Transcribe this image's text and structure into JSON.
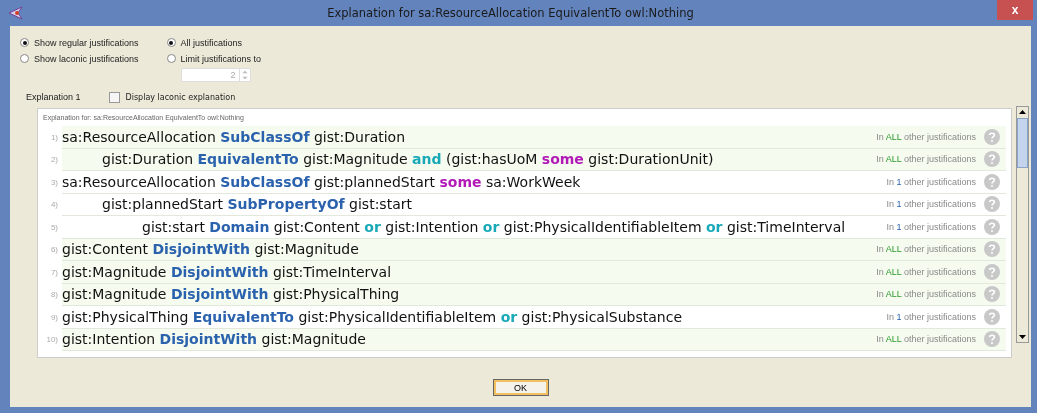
{
  "window": {
    "title": "Explanation for sa:ResourceAllocation EquivalentTo owl:Nothing",
    "close": "x"
  },
  "display_mode": [
    {
      "label": "Show regular justifications",
      "selected": true
    },
    {
      "label": "Show laconic justifications",
      "selected": false
    }
  ],
  "limit_mode": [
    {
      "label": "All justifications",
      "selected": true
    },
    {
      "label": "Limit justifications to",
      "selected": false
    }
  ],
  "limit_spinner": {
    "value": "2",
    "disabled": true
  },
  "explanation": {
    "label": "Explanation 1",
    "laconic_checkbox": {
      "label": "Display laconic explanation",
      "checked": false
    },
    "header": "Explanation for: sa:ResourceAllocation EquivalentTo owl:Nothing",
    "rows": [
      {
        "number": "1)",
        "shared": true,
        "usage": {
          "prefix": "In",
          "count": "ALL",
          "suffix": "other justifications"
        },
        "segments": [
          {
            "text": "sa:ResourceAllocation",
            "kind": "entity"
          },
          {
            "text": "SubClassOf",
            "kind": "keyword"
          },
          {
            "text": "gist:Duration",
            "kind": "entity"
          }
        ],
        "children": [
          {
            "number": "2)",
            "shared": true,
            "usage": {
              "prefix": "In",
              "count": "ALL",
              "suffix": "other justifications"
            },
            "segments": [
              {
                "text": "gist:Duration",
                "kind": "entity"
              },
              {
                "text": "EquivalentTo",
                "kind": "keyword"
              },
              {
                "text": "gist:Magnitude",
                "kind": "entity"
              },
              {
                "text": "and",
                "kind": "connective"
              },
              {
                "text": "(gist:hasUoM",
                "kind": "entity"
              },
              {
                "text": "some",
                "kind": "quantifier"
              },
              {
                "text": "gist:DurationUnit)",
                "kind": "entity"
              }
            ]
          }
        ]
      },
      {
        "number": "3)",
        "shared": false,
        "usage": {
          "prefix": "In",
          "count": "1",
          "suffix": "other justifications"
        },
        "segments": [
          {
            "text": "sa:ResourceAllocation",
            "kind": "entity"
          },
          {
            "text": "SubClassOf",
            "kind": "keyword"
          },
          {
            "text": "gist:plannedStart",
            "kind": "entity"
          },
          {
            "text": "some",
            "kind": "quantifier"
          },
          {
            "text": "sa:WorkWeek",
            "kind": "entity"
          }
        ],
        "children": [
          {
            "number": "4)",
            "shared": false,
            "usage": {
              "prefix": "In",
              "count": "1",
              "suffix": "other justifications"
            },
            "segments": [
              {
                "text": "gist:plannedStart",
                "kind": "entity"
              },
              {
                "text": "SubPropertyOf",
                "kind": "keyword"
              },
              {
                "text": "gist:start",
                "kind": "entity"
              }
            ],
            "children": [
              {
                "number": "5)",
                "shared": false,
                "usage": {
                  "prefix": "In",
                  "count": "1",
                  "suffix": "other justifications"
                },
                "segments": [
                  {
                    "text": "gist:start",
                    "kind": "entity"
                  },
                  {
                    "text": "Domain",
                    "kind": "keyword"
                  },
                  {
                    "text": "gist:Content",
                    "kind": "entity"
                  },
                  {
                    "text": "or",
                    "kind": "connective"
                  },
                  {
                    "text": "gist:Intention",
                    "kind": "entity"
                  },
                  {
                    "text": "or",
                    "kind": "connective"
                  },
                  {
                    "text": "gist:PhysicalIdentifiableItem",
                    "kind": "entity"
                  },
                  {
                    "text": "or",
                    "kind": "connective"
                  },
                  {
                    "text": "gist:TimeInterval",
                    "kind": "entity"
                  }
                ]
              }
            ]
          }
        ]
      },
      {
        "number": "6)",
        "shared": true,
        "usage": {
          "prefix": "In",
          "count": "ALL",
          "suffix": "other justifications"
        },
        "segments": [
          {
            "text": "gist:Content",
            "kind": "entity"
          },
          {
            "text": "DisjointWith",
            "kind": "keyword"
          },
          {
            "text": "gist:Magnitude",
            "kind": "entity"
          }
        ]
      },
      {
        "number": "7)",
        "shared": true,
        "usage": {
          "prefix": "In",
          "count": "ALL",
          "suffix": "other justifications"
        },
        "segments": [
          {
            "text": "gist:Magnitude",
            "kind": "entity"
          },
          {
            "text": "DisjointWith",
            "kind": "keyword"
          },
          {
            "text": "gist:TimeInterval",
            "kind": "entity"
          }
        ]
      },
      {
        "number": "8)",
        "shared": true,
        "usage": {
          "prefix": "In",
          "count": "ALL",
          "suffix": "other justifications"
        },
        "segments": [
          {
            "text": "gist:Magnitude",
            "kind": "entity"
          },
          {
            "text": "DisjointWith",
            "kind": "keyword"
          },
          {
            "text": "gist:PhysicalThing",
            "kind": "entity"
          }
        ]
      },
      {
        "number": "9)",
        "shared": false,
        "usage": {
          "prefix": "In",
          "count": "1",
          "suffix": "other justifications"
        },
        "segments": [
          {
            "text": "gist:PhysicalThing",
            "kind": "entity"
          },
          {
            "text": "EquivalentTo",
            "kind": "keyword"
          },
          {
            "text": "gist:PhysicalIdentifiableItem",
            "kind": "entity"
          },
          {
            "text": "or",
            "kind": "connective"
          },
          {
            "text": "gist:PhysicalSubstance",
            "kind": "entity"
          }
        ]
      },
      {
        "number": "10)",
        "shared": true,
        "usage": {
          "prefix": "In",
          "count": "ALL",
          "suffix": "other justifications"
        },
        "segments": [
          {
            "text": "gist:Intention",
            "kind": "entity"
          },
          {
            "text": "DisjointWith",
            "kind": "keyword"
          },
          {
            "text": "gist:Magnitude",
            "kind": "entity"
          }
        ]
      }
    ]
  },
  "ok_button": "OK"
}
